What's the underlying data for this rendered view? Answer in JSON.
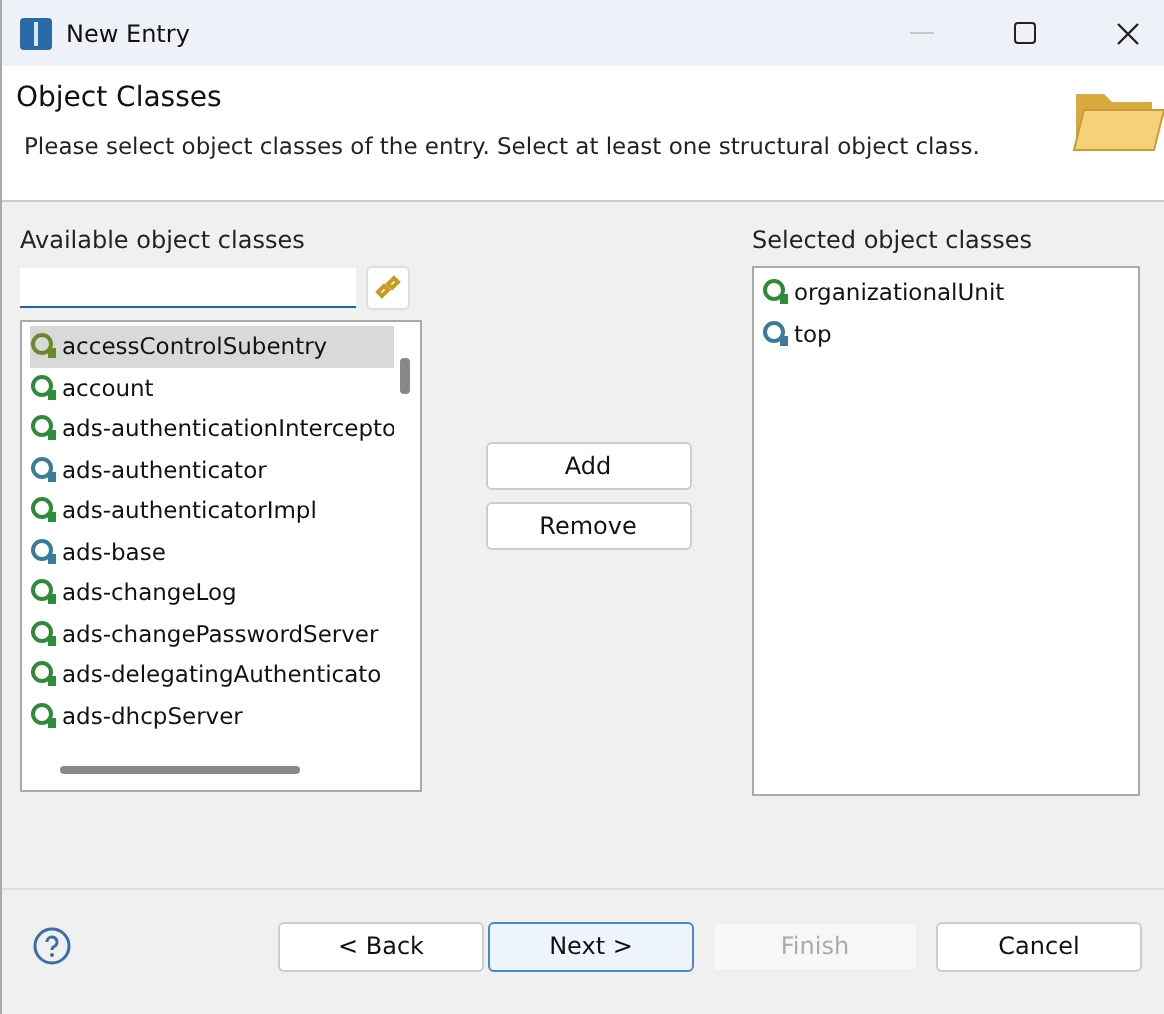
{
  "window": {
    "title": "New Entry"
  },
  "header": {
    "title": "Object Classes",
    "description": "Please select object classes of the entry. Select at least one structural object class."
  },
  "available": {
    "label": "Available object classes",
    "items": [
      {
        "name": "accessControlSubentry",
        "kind": "auxiliary",
        "selected": true
      },
      {
        "name": "account",
        "kind": "structural",
        "selected": false
      },
      {
        "name": "ads-authenticationIntercepto",
        "kind": "structural",
        "selected": false
      },
      {
        "name": "ads-authenticator",
        "kind": "abstract",
        "selected": false
      },
      {
        "name": "ads-authenticatorImpl",
        "kind": "structural",
        "selected": false
      },
      {
        "name": "ads-base",
        "kind": "abstract",
        "selected": false
      },
      {
        "name": "ads-changeLog",
        "kind": "structural",
        "selected": false
      },
      {
        "name": "ads-changePasswordServer",
        "kind": "structural",
        "selected": false
      },
      {
        "name": "ads-delegatingAuthenticato",
        "kind": "structural",
        "selected": false
      },
      {
        "name": "ads-dhcpServer",
        "kind": "structural",
        "selected": false
      }
    ]
  },
  "actions": [
    {
      "label": "Add"
    },
    {
      "label": "Remove"
    }
  ],
  "selected_classes": {
    "label": "Selected object classes",
    "items": [
      {
        "name": "organizationalUnit",
        "kind": "structural"
      },
      {
        "name": "top",
        "kind": "abstract"
      }
    ]
  },
  "buttons": [
    {
      "label": "< Back",
      "default": false,
      "disabled": false
    },
    {
      "label": "Next >",
      "default": true,
      "disabled": false
    },
    {
      "label": "Finish",
      "default": false,
      "disabled": true
    },
    {
      "label": "Cancel",
      "default": false,
      "disabled": false
    }
  ]
}
